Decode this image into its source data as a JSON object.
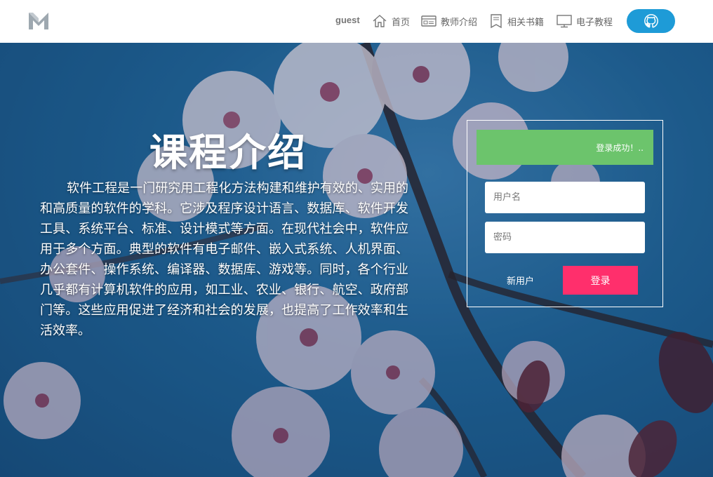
{
  "header": {
    "user": "guest",
    "nav": [
      {
        "label": "首页",
        "icon": "home-icon"
      },
      {
        "label": "教师介绍",
        "icon": "id-card-icon"
      },
      {
        "label": "相关书籍",
        "icon": "book-icon"
      },
      {
        "label": "电子教程",
        "icon": "monitor-icon"
      }
    ],
    "github_icon": "github-icon"
  },
  "intro": {
    "title": "课程介绍",
    "body": "软件工程是一门研究用工程化方法构建和维护有效的、实用的和高质量的软件的学科。它涉及程序设计语言、数据库、软件开发工具、系统平台、标准、设计模式等方面。在现代社会中，软件应用于多个方面。典型的软件有电子邮件、嵌入式系统、人机界面、办公套件、操作系统、编译器、数据库、游戏等。同时，各个行业几乎都有计算机软件的应用，如工业、农业、银行、航空、政府部门等。这些应用促进了经济和社会的发展，也提高了工作效率和生活效率。"
  },
  "login": {
    "status": "登录成功！..",
    "username_placeholder": "用户名",
    "password_placeholder": "密码",
    "register_label": "新用户",
    "login_label": "登录"
  },
  "colors": {
    "success": "#6cc46c",
    "login_button": "#ff2f6c",
    "github_button": "#1e9bd7",
    "background": "#1d5f92"
  }
}
